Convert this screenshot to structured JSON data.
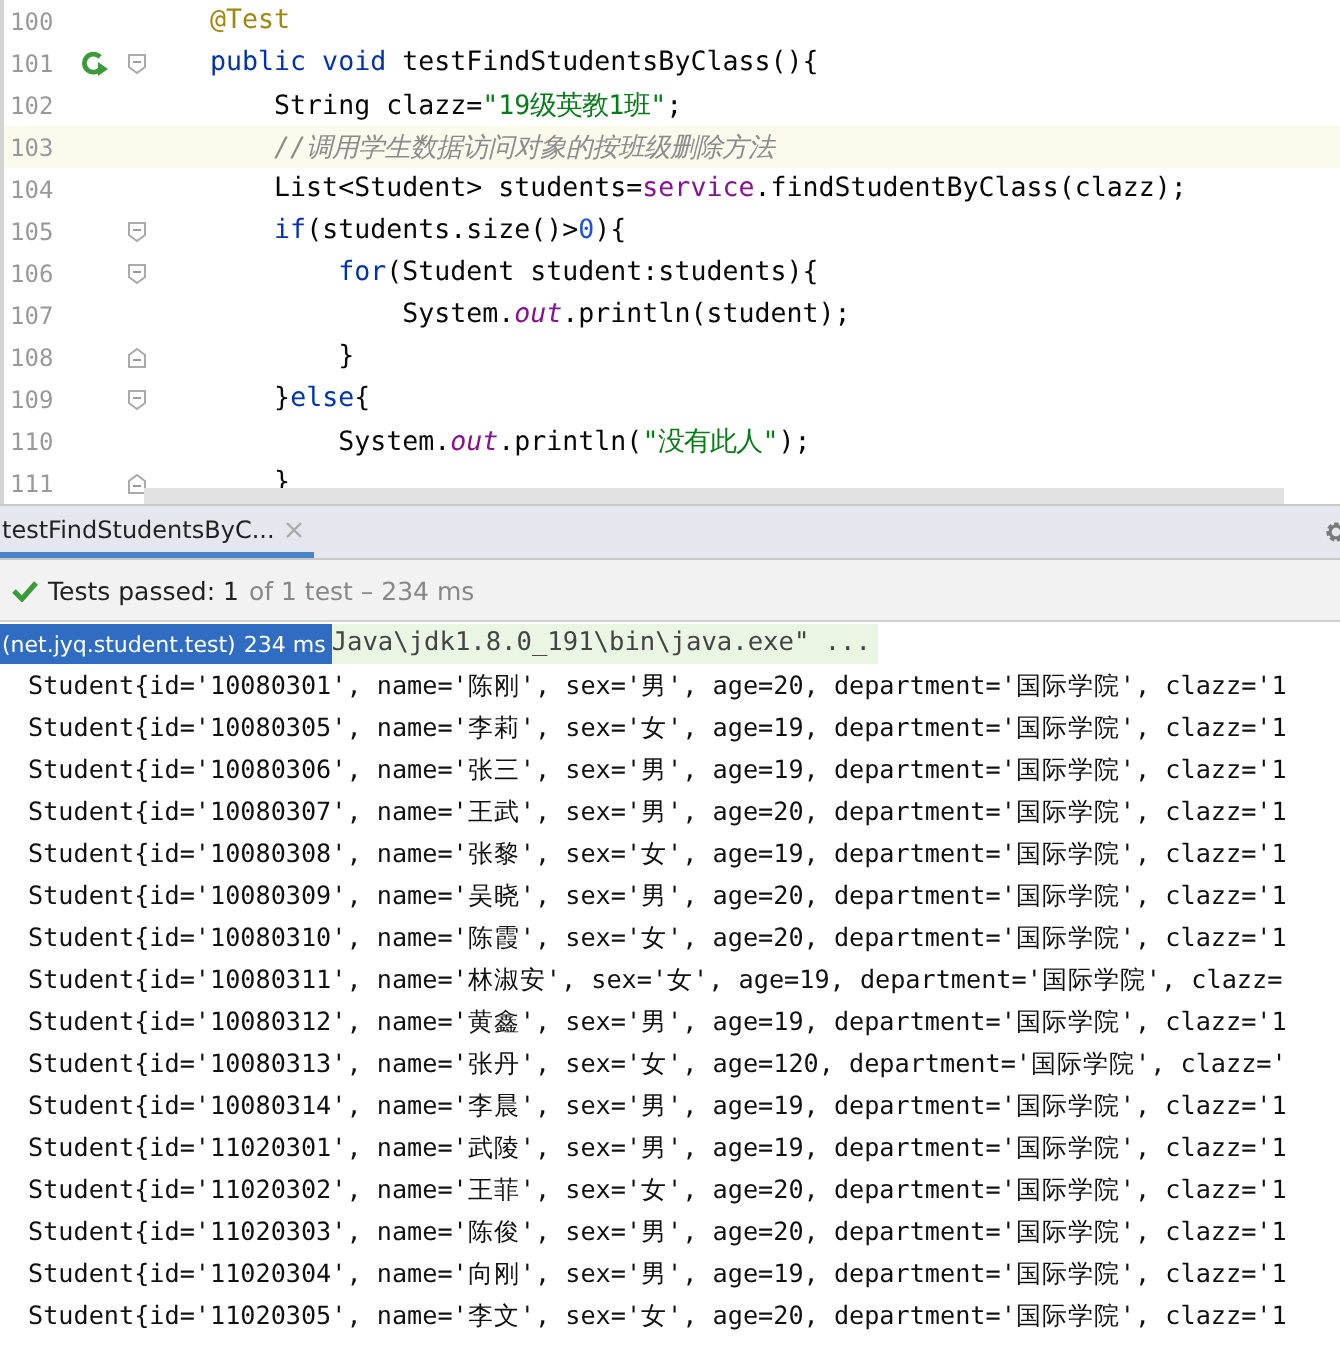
{
  "editor": {
    "lines": [
      {
        "number": "100",
        "current": false,
        "tokens": [
          {
            "kind": "annotation",
            "text": "    @Test"
          }
        ]
      },
      {
        "number": "101",
        "current": false,
        "run_icon": true,
        "fold": {
          "kind": "start"
        },
        "tokens": [
          {
            "kind": "keyword",
            "text": "    public void"
          },
          {
            "kind": "plain",
            "text": " testFindStudentsByClass(){"
          }
        ]
      },
      {
        "number": "102",
        "current": false,
        "tokens": [
          {
            "kind": "plain",
            "text": "        String clazz="
          },
          {
            "kind": "string",
            "text": "\"19级英教1班\""
          },
          {
            "kind": "plain",
            "text": ";"
          }
        ]
      },
      {
        "number": "103",
        "current": true,
        "tokens": [
          {
            "kind": "comment",
            "text": "        //调用学生数据访问对象的按班级删除方法"
          }
        ]
      },
      {
        "number": "104",
        "current": false,
        "tokens": [
          {
            "kind": "plain",
            "text": "        List<Student> students="
          },
          {
            "kind": "field",
            "text": "service"
          },
          {
            "kind": "plain",
            "text": ".findStudentByClass(clazz);"
          }
        ]
      },
      {
        "number": "105",
        "current": false,
        "fold": {
          "kind": "start"
        },
        "tokens": [
          {
            "kind": "keyword",
            "text": "        if"
          },
          {
            "kind": "plain",
            "text": "(students.size()>"
          },
          {
            "kind": "number",
            "text": "0"
          },
          {
            "kind": "plain",
            "text": "){"
          }
        ]
      },
      {
        "number": "106",
        "current": false,
        "fold": {
          "kind": "start"
        },
        "tokens": [
          {
            "kind": "keyword",
            "text": "            for"
          },
          {
            "kind": "plain",
            "text": "(Student student:students){"
          }
        ]
      },
      {
        "number": "107",
        "current": false,
        "tokens": [
          {
            "kind": "plain",
            "text": "                System."
          },
          {
            "kind": "static",
            "text": "out"
          },
          {
            "kind": "plain",
            "text": ".println(student);"
          }
        ]
      },
      {
        "number": "108",
        "current": false,
        "fold": {
          "kind": "end"
        },
        "tokens": [
          {
            "kind": "plain",
            "text": "            }"
          }
        ]
      },
      {
        "number": "109",
        "current": false,
        "fold": {
          "kind": "start"
        },
        "tokens": [
          {
            "kind": "plain",
            "text": "        }"
          },
          {
            "kind": "keyword",
            "text": "else"
          },
          {
            "kind": "plain",
            "text": "{"
          }
        ]
      },
      {
        "number": "110",
        "current": false,
        "tokens": [
          {
            "kind": "plain",
            "text": "            System."
          },
          {
            "kind": "static",
            "text": "out"
          },
          {
            "kind": "plain",
            "text": ".println("
          },
          {
            "kind": "string",
            "text": "\"没有此人\""
          },
          {
            "kind": "plain",
            "text": ");"
          }
        ]
      },
      {
        "number": "111",
        "current": false,
        "fold": {
          "kind": "end"
        },
        "tokens": [
          {
            "kind": "plain",
            "text": "        }"
          }
        ]
      }
    ]
  },
  "run_panel": {
    "tabs": [
      {
        "label": "testFindStudentsByC...",
        "selected": true
      }
    ],
    "status": {
      "passed": "Tests passed: 1",
      "detail": "of 1 test – 234 ms"
    },
    "tree_item": {
      "label": "(net.jyq.student.test)",
      "time": "234 ms",
      "selected": true
    },
    "command": "Java\\jdk1.8.0_191\\bin\\java.exe\" ...",
    "output": [
      "Student{id='10080301', name='陈刚', sex='男', age=20, department='国际学院', clazz='1",
      "Student{id='10080305', name='李莉', sex='女', age=19, department='国际学院', clazz='1",
      "Student{id='10080306', name='张三', sex='男', age=19, department='国际学院', clazz='1",
      "Student{id='10080307', name='王武', sex='男', age=20, department='国际学院', clazz='1",
      "Student{id='10080308', name='张黎', sex='女', age=19, department='国际学院', clazz='1",
      "Student{id='10080309', name='吴晓', sex='男', age=20, department='国际学院', clazz='1",
      "Student{id='10080310', name='陈霞', sex='女', age=20, department='国际学院', clazz='1",
      "Student{id='10080311', name='林淑安', sex='女', age=19, department='国际学院', clazz=",
      "Student{id='10080312', name='黄鑫', sex='男', age=19, department='国际学院', clazz='1",
      "Student{id='10080313', name='张丹', sex='女', age=120, department='国际学院', clazz='",
      "Student{id='10080314', name='李晨', sex='男', age=19, department='国际学院', clazz='1",
      "Student{id='11020301', name='武陵', sex='男', age=19, department='国际学院', clazz='1",
      "Student{id='11020302', name='王菲', sex='女', age=20, department='国际学院', clazz='1",
      "Student{id='11020303', name='陈俊', sex='男', age=20, department='国际学院', clazz='1",
      "Student{id='11020304', name='向刚', sex='男', age=19, department='国际学院', clazz='1",
      "Student{id='11020305', name='李文', sex='女', age=20, department='国际学院', clazz='1"
    ]
  }
}
